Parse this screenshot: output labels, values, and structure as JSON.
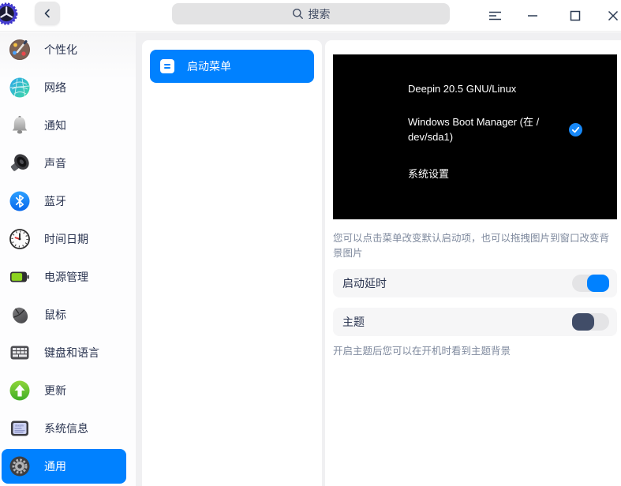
{
  "titlebar": {
    "search_placeholder": "搜索"
  },
  "sidebar": {
    "items": [
      {
        "label": "个性化"
      },
      {
        "label": "网络"
      },
      {
        "label": "通知"
      },
      {
        "label": "声音"
      },
      {
        "label": "蓝牙"
      },
      {
        "label": "时间日期"
      },
      {
        "label": "电源管理"
      },
      {
        "label": "鼠标"
      },
      {
        "label": "键盘和语言"
      },
      {
        "label": "更新"
      },
      {
        "label": "系统信息"
      },
      {
        "label": "通用"
      }
    ],
    "selected_index": 11
  },
  "nav": {
    "selected_label": "启动菜单"
  },
  "boot": {
    "entries": {
      "deepin": "Deepin 20.5 GNU/Linux",
      "windows_line1": "Windows Boot Manager (在 /",
      "windows_line2": "dev/sda1)",
      "settings": "系统设置"
    },
    "selected_entry": "Windows Boot Manager (在 /dev/sda1)",
    "hint": "您可以点击菜单改变默认启动项，也可以拖拽图片到窗口改变背景图片",
    "delay_label": "启动延时",
    "delay_state": "on",
    "theme_label": "主题",
    "theme_state": "off",
    "theme_hint": "开启主题后您可以在开机时看到主题背景"
  },
  "colors": {
    "accent": "#0081ff",
    "toggle_off_knob": "#414d68",
    "boot_bg": "#000000"
  }
}
